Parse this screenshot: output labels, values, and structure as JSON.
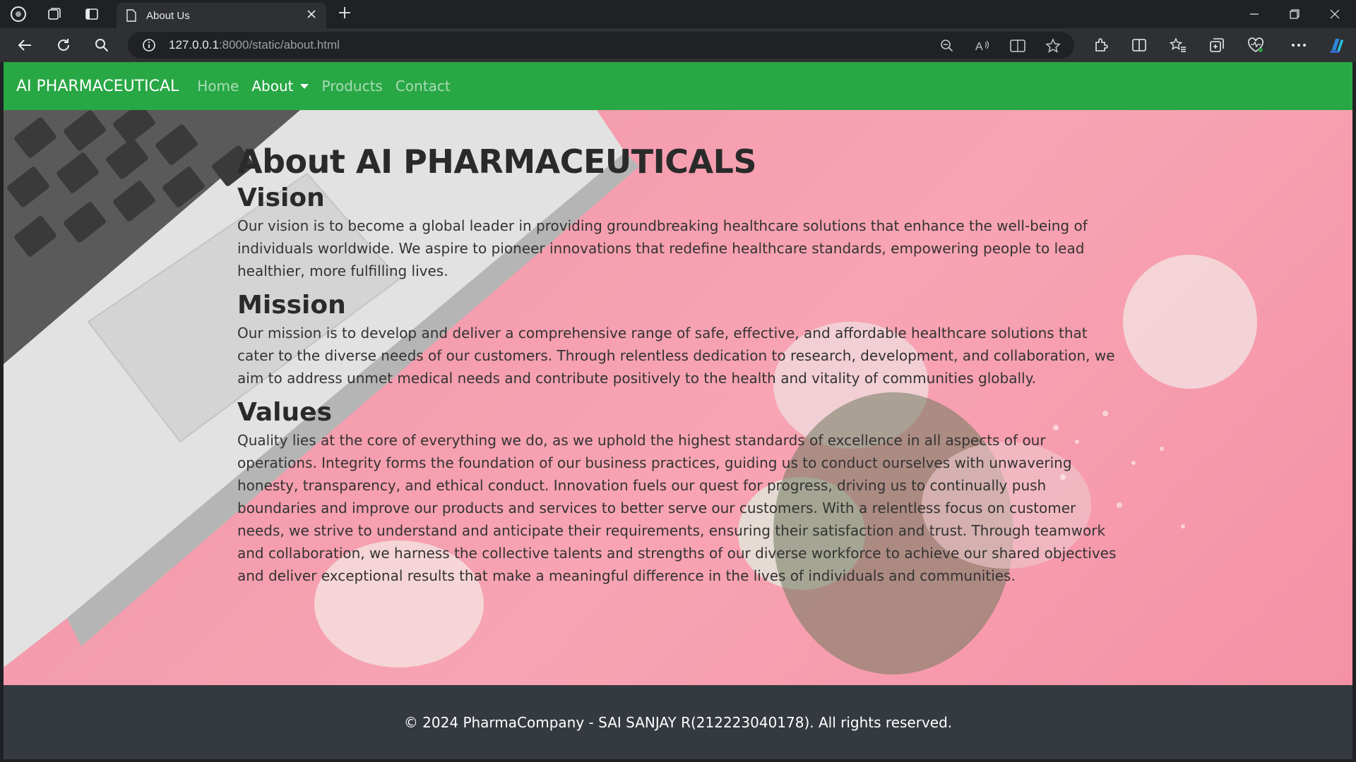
{
  "browser": {
    "tab_title": "About Us",
    "url_host": "127.0.0.1",
    "url_rest": ":8000/static/about.html"
  },
  "navbar": {
    "brand": "AI PHARMACEUTICAL",
    "links": {
      "home": "Home",
      "about": "About",
      "products": "Products",
      "contact": "Contact"
    },
    "color": "#28a745"
  },
  "content": {
    "title": "About AI PHARMACEUTICALS",
    "vision": {
      "heading": "Vision",
      "text": "Our vision is to become a global leader in providing groundbreaking healthcare solutions that enhance the well-being of individuals worldwide. We aspire to pioneer innovations that redefine healthcare standards, empowering people to lead healthier, more fulfilling lives."
    },
    "mission": {
      "heading": "Mission",
      "text": "Our mission is to develop and deliver a comprehensive range of safe, effective, and affordable healthcare solutions that cater to the diverse needs of our customers. Through relentless dedication to research, development, and collaboration, we aim to address unmet medical needs and contribute positively to the health and vitality of communities globally."
    },
    "values": {
      "heading": "Values",
      "text": "Quality lies at the core of everything we do, as we uphold the highest standards of excellence in all aspects of our operations. Integrity forms the foundation of our business practices, guiding us to conduct ourselves with unwavering honesty, transparency, and ethical conduct. Innovation fuels our quest for progress, driving us to continually push boundaries and improve our products and services to better serve our customers. With a relentless focus on customer needs, we strive to understand and anticipate their requirements, ensuring their satisfaction and trust. Through teamwork and collaboration, we harness the collective talents and strengths of our diverse workforce to achieve our shared objectives and deliver exceptional results that make a meaningful difference in the lives of individuals and communities."
    }
  },
  "footer": {
    "text": "© 2024 PharmaCompany - SAI SANJAY R(212223040178). All rights reserved.",
    "color": "#343a40"
  },
  "icons": [
    "app-menu-icon",
    "workspaces-icon",
    "tab-actions-icon",
    "page-icon",
    "close-icon",
    "new-tab-icon",
    "minimize-icon",
    "restore-icon",
    "window-close-icon",
    "back-icon",
    "refresh-icon",
    "search-icon",
    "info-icon",
    "zoom-out-icon",
    "read-aloud-icon",
    "immersive-reader-icon",
    "favorite-star-icon",
    "extensions-icon",
    "split-screen-icon",
    "favorites-icon",
    "collections-icon",
    "browser-essentials-icon",
    "more-icon",
    "copilot-icon"
  ]
}
